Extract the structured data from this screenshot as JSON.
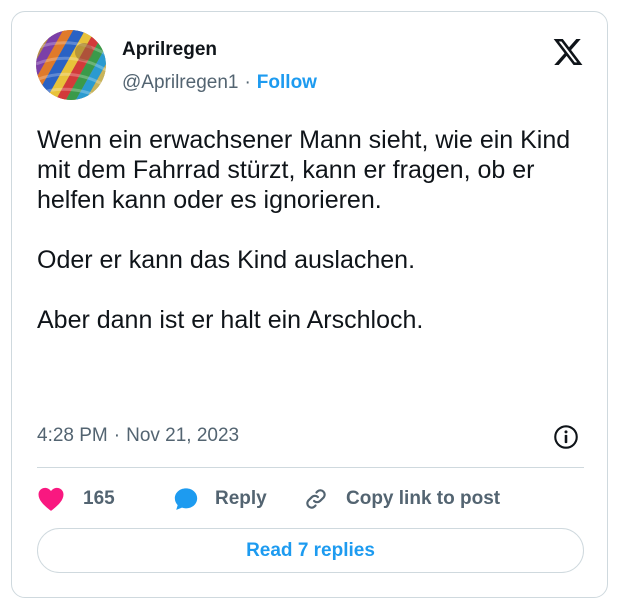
{
  "author": {
    "display_name": "Aprilregen",
    "handle": "@Aprilregen1",
    "separator": "·",
    "follow_label": "Follow",
    "avatar_icon": "knitted-wool-avatar"
  },
  "platform_icon": "x-logo-icon",
  "tweet": {
    "paragraphs": [
      "Wenn ein erwachsener Mann sieht, wie ein Kind mit dem Fahrrad stürzt, kann er fragen, ob er helfen kann oder es ignorieren.",
      "Oder er kann das Kind auslachen.",
      "Aber dann ist er halt ein Arschloch."
    ],
    "time": "4:28 PM",
    "separator": "·",
    "date": "Nov 21, 2023"
  },
  "actions": {
    "like_count": "165",
    "reply_label": "Reply",
    "copy_link_label": "Copy link to post"
  },
  "read_replies_label": "Read 7 replies",
  "colors": {
    "accent": "#1d9bf0",
    "like": "#f91880",
    "text": "#0f1419",
    "muted": "#536471",
    "border": "#cfd9de"
  }
}
